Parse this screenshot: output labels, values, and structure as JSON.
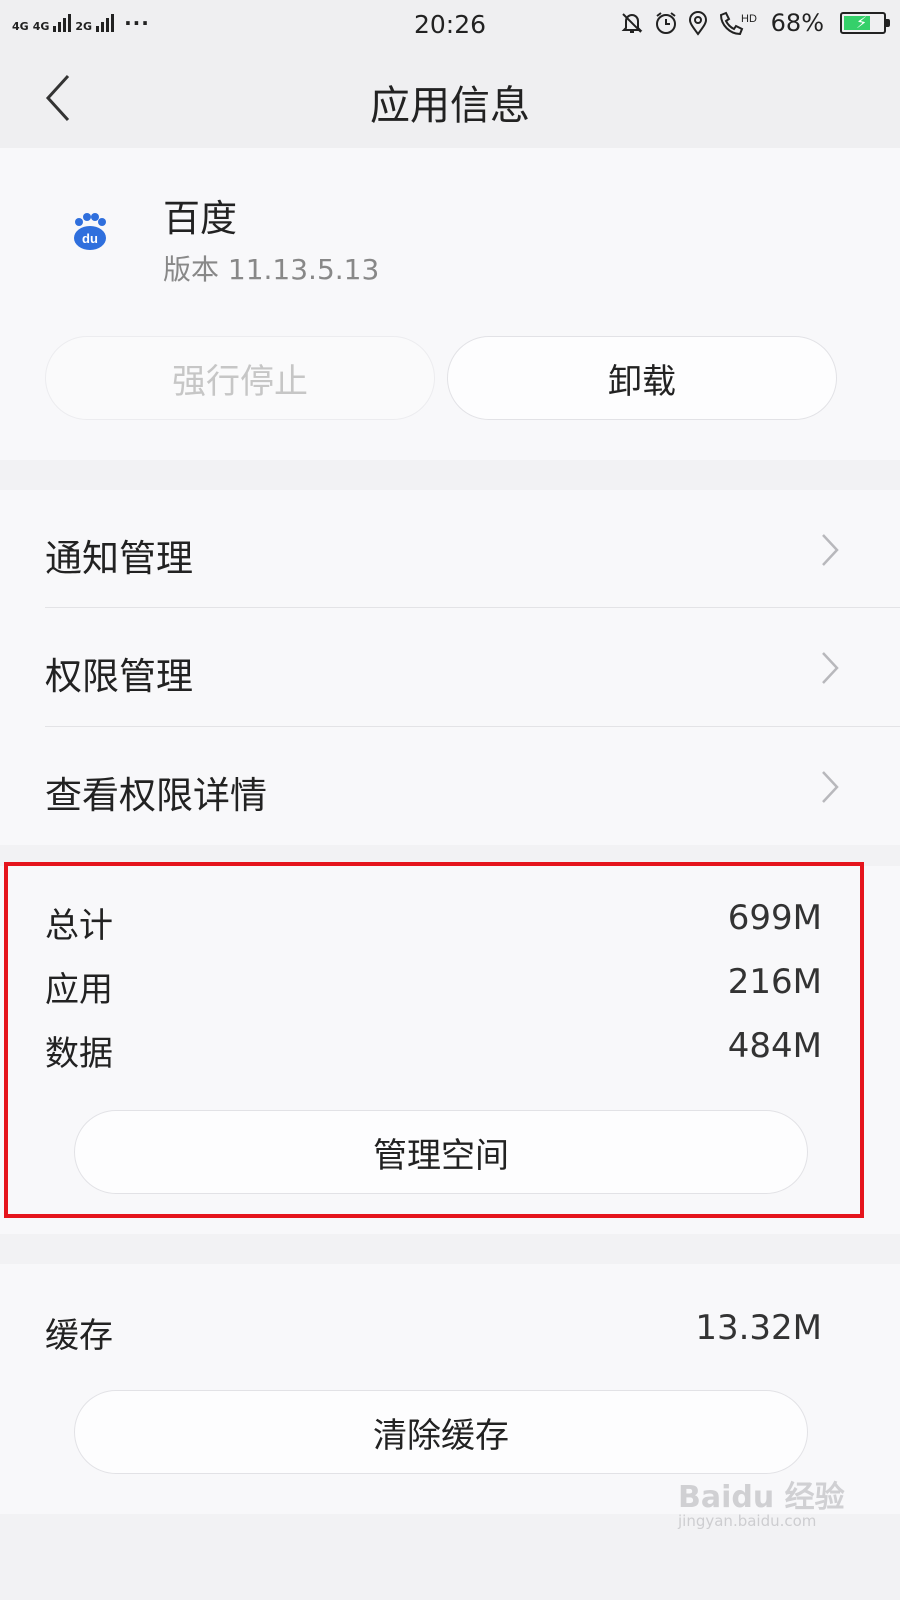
{
  "status_bar": {
    "network_labels": [
      "4G",
      "4G",
      "2G"
    ],
    "more_indicator": "···",
    "time": "20:26",
    "icons": [
      "bell-mute-icon",
      "alarm-icon",
      "location-icon",
      "hd-call-icon"
    ],
    "hd_label": "HD",
    "battery_percent": "68%",
    "battery_level": 0.68,
    "charging": true
  },
  "header": {
    "title": "应用信息",
    "back_icon": "chevron-left-icon"
  },
  "app": {
    "name": "百度",
    "version": "版本 11.13.5.13",
    "icon_text": "du",
    "icon_color": "#2f6fdd",
    "force_stop_label": "强行停止",
    "force_stop_enabled": false,
    "uninstall_label": "卸载"
  },
  "nav_items": [
    {
      "label": "通知管理"
    },
    {
      "label": "权限管理"
    },
    {
      "label": "查看权限详情"
    }
  ],
  "storage": {
    "rows": [
      {
        "label": "总计",
        "value": "699M"
      },
      {
        "label": "应用",
        "value": "216M"
      },
      {
        "label": "数据",
        "value": "484M"
      }
    ],
    "manage_button_label": "管理空间",
    "highlight_color": "#e5141c"
  },
  "cache": {
    "label": "缓存",
    "value": "13.32M",
    "clear_button_label": "清除缓存"
  },
  "watermark": {
    "brand": "Baidu 经验",
    "url": "jingyan.baidu.com"
  }
}
